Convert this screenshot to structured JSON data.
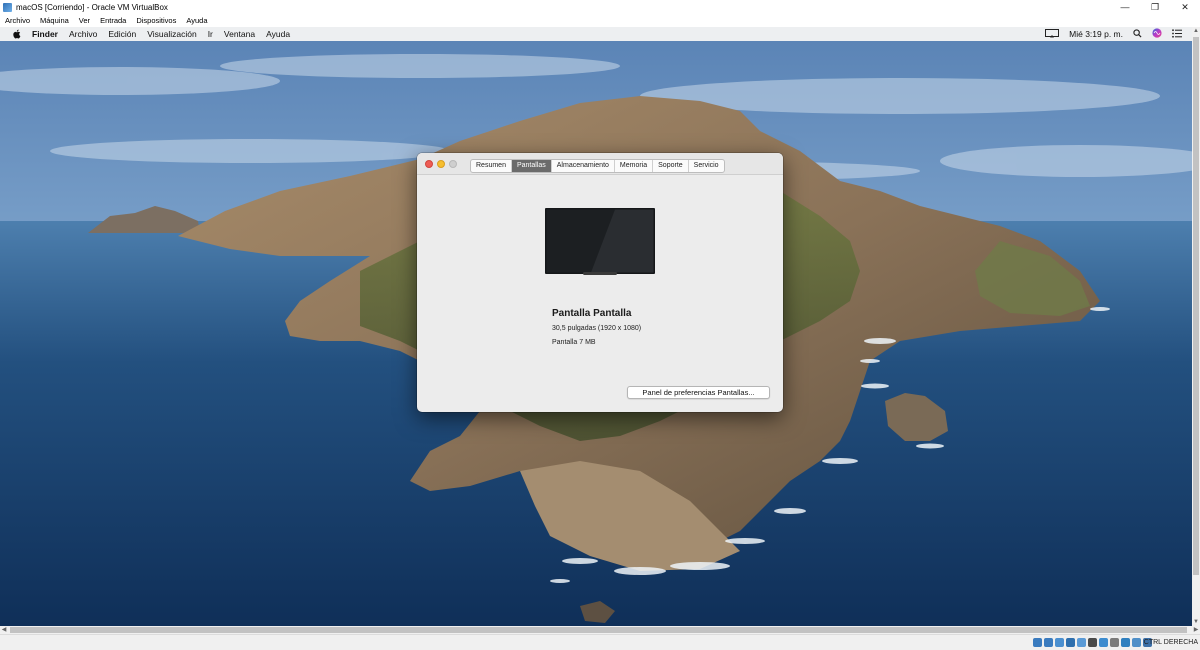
{
  "window": {
    "title": "macOS [Corriendo] - Oracle VM VirtualBox",
    "controls": [
      "—",
      "❐",
      "✕"
    ]
  },
  "vbox_menu": [
    "Archivo",
    "Máquina",
    "Ver",
    "Entrada",
    "Dispositivos",
    "Ayuda"
  ],
  "mac_menubar": {
    "app": "Finder",
    "items": [
      "Archivo",
      "Edición",
      "Visualización",
      "Ir",
      "Ventana",
      "Ayuda"
    ],
    "clock": "Mié 3:19 p. m."
  },
  "dialog": {
    "tabs": [
      "Resumen",
      "Pantallas",
      "Almacenamiento",
      "Memoria",
      "Soporte",
      "Servicio"
    ],
    "active_tab": "Pantallas",
    "display_name": "Pantalla Pantalla",
    "display_size": "30,5 pulgadas (1920 x 1080)",
    "display_memory": "Pantalla 7 MB",
    "prefs_button": "Panel de preferencias Pantallas..."
  },
  "statusbar": {
    "host_key": "CTRL DERECHA",
    "icons": [
      "hard-disk-icon",
      "optical-drive-icon",
      "audio-icon",
      "network-icon",
      "usb-icon",
      "shared-folder-icon",
      "display-icon",
      "recording-icon",
      "cpu-icon",
      "mouse-integration-icon",
      "keyboard-icon"
    ],
    "icon_colors": [
      "#3a7bbf",
      "#3a7bbf",
      "#4a8fd0",
      "#2e6fae",
      "#5a9ad6",
      "#4a4a4a",
      "#3d8ccf",
      "#7a7a7a",
      "#2f7fbf",
      "#4f8fc8",
      "#3b6fa8"
    ]
  }
}
